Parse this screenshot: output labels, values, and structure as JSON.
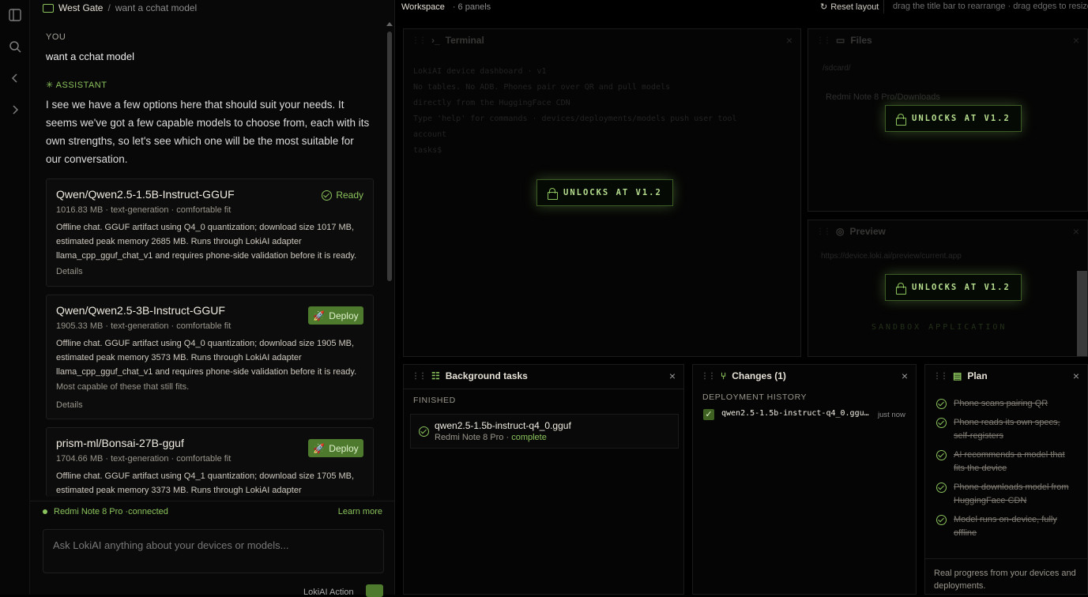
{
  "rail": {
    "icons": [
      "sidebar-icon",
      "search-icon",
      "chevron-left-icon",
      "chevron-right-icon"
    ]
  },
  "chat": {
    "breadcrumb": {
      "project": "West Gate",
      "separator": "/",
      "thread": "want a cchat model"
    },
    "you_label": "YOU",
    "you_msg": "want a cchat model",
    "assistant_label": "✳ ASSISTANT",
    "assistant_msg": "I see we have a few options here that should suit your needs. It seems we've got a few capable models to choose from, each with its own strengths, so let's see which one will be the most suitable for our conversation.",
    "cards": [
      {
        "name": "Qwen/Qwen2.5-1.5B-Instruct-GGUF",
        "meta": "1016.83 MB · text-generation · comfortable fit",
        "desc": "Offline chat. GGUF artifact using Q4_0 quantization; download size 1017 MB, estimated peak memory 2685 MB. Runs through LokiAI adapter llama_cpp_gguf_chat_v1 and requires phone-side validation before it is ready.",
        "status": "Ready",
        "details": "Details"
      },
      {
        "name": "Qwen/Qwen2.5-3B-Instruct-GGUF",
        "meta": "1905.33 MB · text-generation · comfortable fit",
        "desc": "Offline chat. GGUF artifact using Q4_0 quantization; download size 1905 MB, estimated peak memory 3573 MB. Runs through LokiAI adapter llama_cpp_gguf_chat_v1 and requires phone-side validation before it is ready.",
        "note": "Most capable of these that still fits.",
        "action": "Deploy",
        "details": "Details"
      },
      {
        "name": "prism-ml/Bonsai-27B-gguf",
        "meta": "1704.66 MB · text-generation · comfortable fit",
        "desc": "Offline chat. GGUF artifact using Q4_1 quantization; download size 1705 MB, estimated peak memory 3373 MB. Runs through LokiAI adapter",
        "action": "Deploy"
      }
    ],
    "device": "Redmi Note 8 Pro · ",
    "device_state": "connected",
    "learn_more": "Learn more",
    "ask_placeholder": "Ask LokiAI anything about your devices or models...",
    "footer_text": "LokiAI Action"
  },
  "workspace": {
    "title": "Workspace",
    "count": "· 6 panels",
    "reset": "Reset layout",
    "hint": "drag the title bar to rearrange · drag edges to resize",
    "unlock": "UNLOCKS AT V1.2",
    "terminal": {
      "title": "Terminal",
      "lines": [
        "LokiAI device dashboard · v1",
        "No tables. No ADB. Phones pair over QR and pull models",
        "directly from the HuggingFace CDN",
        "Type 'help' for commands · devices/deployments/models  push  user  tool",
        "account",
        "tasks$"
      ]
    },
    "files": {
      "title": "Files",
      "path": "/sdcard/",
      "item": "Redmi Note 8 Pro/Downloads"
    },
    "preview": {
      "title": "Preview",
      "url": "https://device.loki.ai/preview/current.app",
      "body": "SANDBOX APPLICATION"
    },
    "bg_tasks": {
      "title": "Background tasks",
      "section": "FINISHED",
      "task_name": "qwen2.5-1.5b-instruct-q4_0.gguf",
      "task_device": "Redmi Note 8 Pro · ",
      "task_state": "complete"
    },
    "changes": {
      "title": "Changes (1)",
      "section": "DEPLOYMENT HISTORY",
      "item": "qwen2.5-1.5b-instruct-q4_0.ggu…",
      "time": "just now"
    },
    "plan": {
      "title": "Plan",
      "items": [
        "Phone scans pairing QR",
        "Phone reads its own specs, self-registers",
        "AI recommends a model that fits the device",
        "Phone downloads model from HuggingFace CDN",
        "Model runs on-device, fully offline"
      ],
      "footer": "Real progress from your devices and deployments."
    }
  },
  "colors": {
    "accent": "#8ac25b",
    "deploy_bg": "#4e7a2d",
    "bg": "#000000"
  }
}
